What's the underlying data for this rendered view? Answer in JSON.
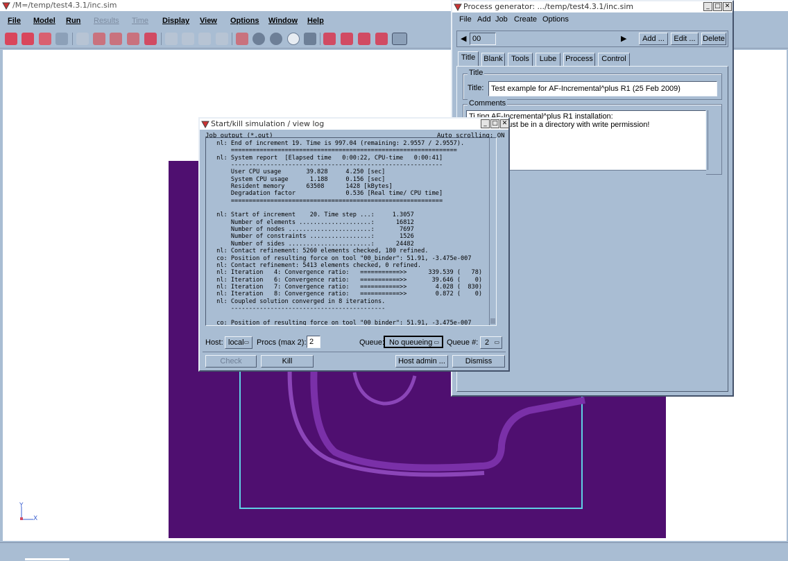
{
  "main_window": {
    "title": "/M=/temp/test4.3.1/inc.sim",
    "menu": [
      "File",
      "Model",
      "Run",
      "Results",
      "Time",
      "Display",
      "View",
      "Options",
      "Window",
      "Help"
    ],
    "menu_disabled": [
      "Results",
      "Time"
    ],
    "axis": {
      "y": "Y",
      "x": "X"
    }
  },
  "log_dialog": {
    "title": "Start/kill simulation / view log",
    "job_output_label": "Job output (*.out)",
    "auto_scroll": "Auto scrolling: ON",
    "log_lines": [
      " nl: End of increment 19. Time is 997.04 (remaining: 2.9557 / 2.9557).",
      "     ===============================================================",
      " nl: System report  [Elapsed time   0:00:22, CPU-time   0:00:41]",
      "     -----------------------------------------------------------",
      "     User CPU usage       39.828     4.250 [sec]",
      "     System CPU usage      1.188     0.156 [sec]",
      "     Resident memory      63508      1428 [kBytes]",
      "     Degradation factor              0.536 [Real time/ CPU time]",
      "     ===========================================================",
      "",
      " nl: Start of increment    20. Time step ...:     1.3057",
      "     Number of elements ....................:      16812",
      "     Number of nodes .......................:       7697",
      "     Number of constraints .................:       1526",
      "     Number of sides .......................:      24482",
      " nl: Contact refinement: 5260 elements checked, 180 refined.",
      " co: Position of resulting force on tool \"00_binder\": 51.91, -3.475e-007",
      " nl: Contact refinement: 5413 elements checked, 0 refined.",
      " nl: Iteration   4: Convergence ratio:   ===========>>      339.539 (   78)",
      " nl: Iteration   6: Convergence ratio:   ===========>>       39.646 (    0)",
      " nl: Iteration   7: Convergence ratio:   ===========>>        4.028 (  830)",
      " nl: Iteration   8: Convergence ratio:   ===========>>        0.872 (    0)",
      " nl: Coupled solution converged in 8 iterations.",
      "     -------------------------------------------",
      "",
      " co: Position of resulting force on tool \"00_binder\": 51.91, -3.475e-007"
    ],
    "host_label": "Host:",
    "host_value": "local",
    "procs_label": "Procs (max 2):",
    "procs_value": "2",
    "queue_label": "Queue:",
    "queue_value": "No queueing",
    "queue_num_label": "Queue #:",
    "queue_num_value": "2",
    "buttons": {
      "check": "Check",
      "kill": "Kill",
      "host_admin": "Host admin ...",
      "dismiss": "Dismiss"
    }
  },
  "process_dialog": {
    "title": "Process generator: .../temp/test4.3.1/inc.sim",
    "menu": [
      "File",
      "Add",
      "Job",
      "Create",
      "Options"
    ],
    "nav_value": "00",
    "buttons": {
      "add": "Add ...",
      "edit": "Edit ...",
      "delete": "Delete"
    },
    "tabs": [
      "Title",
      "Blank",
      "Tools",
      "Lube",
      "Process",
      "Control"
    ],
    "active_tab": "Title",
    "title_group_label": "Title",
    "title_field_label": "Title:",
    "title_value": "Test example for AF-Incremental^plus R1 (25 Feb 2009)",
    "comments_group_label": "Comments",
    "comments_lines": [
      "Ti  ting AF-Incremental^plus R1 installation:",
      "      ation, file must be in a directory with write permission!"
    ]
  }
}
